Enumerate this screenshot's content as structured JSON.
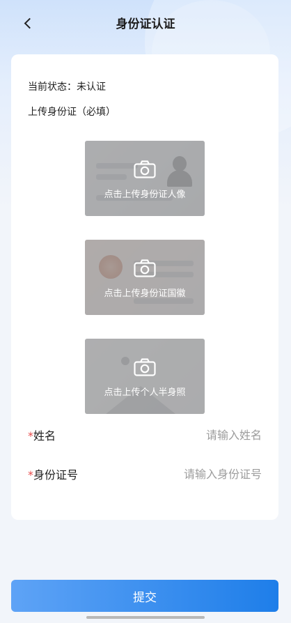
{
  "nav": {
    "title": "身份证认证"
  },
  "status": {
    "text": "当前状态：未认证"
  },
  "upload": {
    "section_title": "上传身份证（必填）",
    "items": [
      {
        "label": "点击上传身份证人像"
      },
      {
        "label": "点击上传身份证国徽"
      },
      {
        "label": "点击上传个人半身照"
      }
    ]
  },
  "form": {
    "name": {
      "required_mark": "*",
      "label": "姓名",
      "placeholder": "请输入姓名"
    },
    "id_number": {
      "required_mark": "*",
      "label": "身份证号",
      "placeholder": "请输入身份证号"
    }
  },
  "submit": {
    "label": "提交"
  },
  "colors": {
    "accent": "#1e7ee9",
    "required": "#e84a4a"
  }
}
